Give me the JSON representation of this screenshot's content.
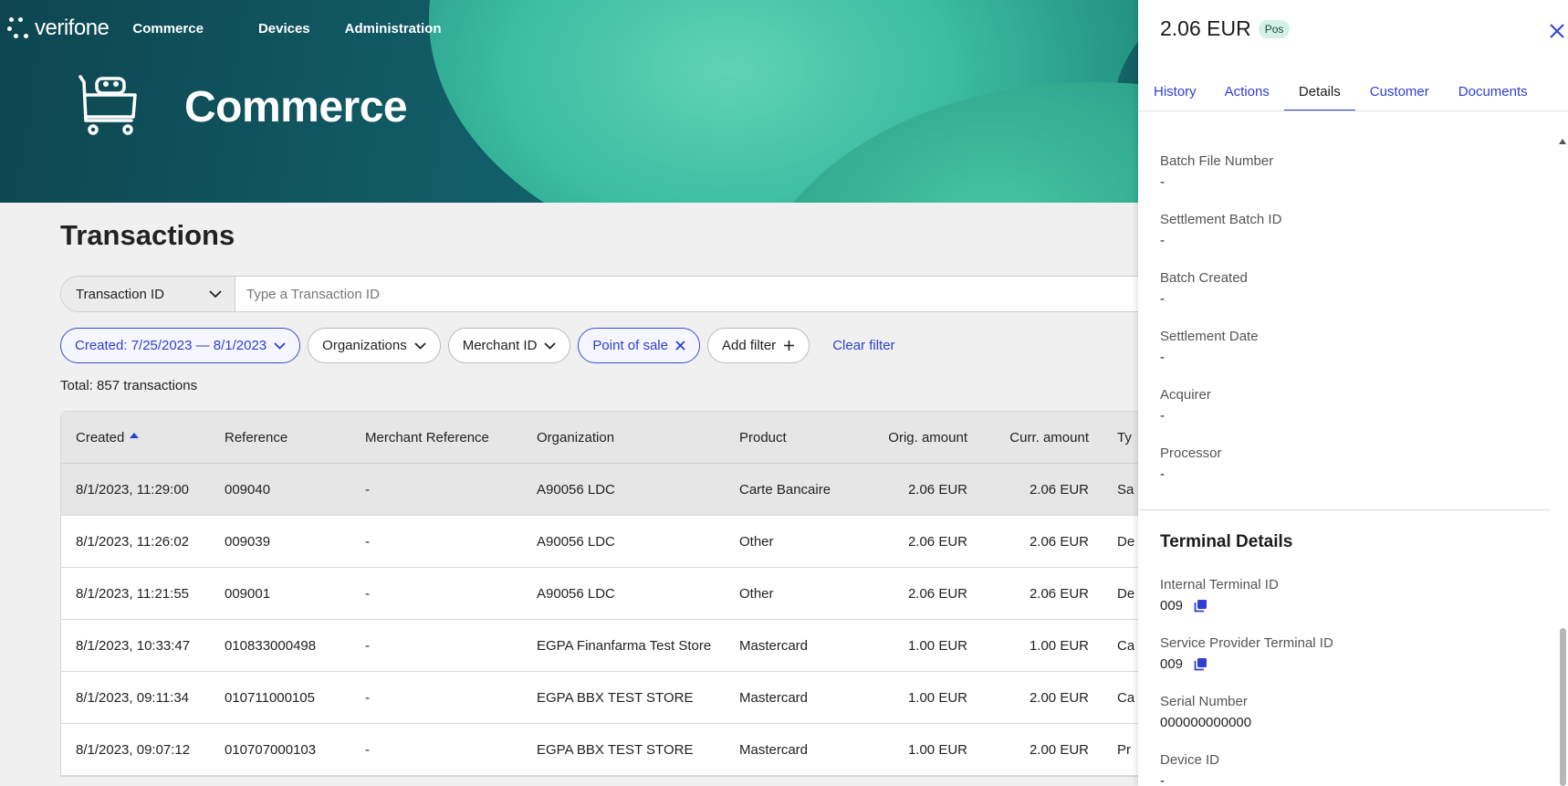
{
  "nav": {
    "logo": "verifone",
    "items": [
      {
        "label": "Commerce"
      },
      {
        "label": "Devices"
      },
      {
        "label": "Administration"
      }
    ]
  },
  "hero": {
    "title": "Commerce"
  },
  "page": {
    "title": "Transactions"
  },
  "search": {
    "selector": "Transaction ID",
    "placeholder": "Type a Transaction ID",
    "value": ""
  },
  "filters": {
    "created": "Created: 7/25/2023 — 8/1/2023",
    "organizations": "Organizations",
    "merchant_id": "Merchant ID",
    "point_of_sale": "Point of sale",
    "add_filter": "Add filter",
    "clear": "Clear filter"
  },
  "total": "Total: 857 transactions",
  "table": {
    "columns": [
      "Created",
      "Reference",
      "Merchant Reference",
      "Organization",
      "Product",
      "Orig. amount",
      "Curr. amount",
      "Ty"
    ],
    "rows": [
      [
        "8/1/2023, 11:29:00",
        "009040",
        "-",
        "A90056 LDC",
        "Carte Bancaire",
        "2.06 EUR",
        "2.06 EUR",
        "Sa"
      ],
      [
        "8/1/2023, 11:26:02",
        "009039",
        "-",
        "A90056 LDC",
        "Other",
        "2.06 EUR",
        "2.06 EUR",
        "De"
      ],
      [
        "8/1/2023, 11:21:55",
        "009001",
        "-",
        "A90056 LDC",
        "Other",
        "2.06 EUR",
        "2.06 EUR",
        "De"
      ],
      [
        "8/1/2023, 10:33:47",
        "010833000498",
        "-",
        "EGPA Finanfarma Test Store",
        "Mastercard",
        "1.00 EUR",
        "1.00 EUR",
        "Ca"
      ],
      [
        "8/1/2023, 09:11:34",
        "010711000105",
        "-",
        "EGPA BBX TEST STORE",
        "Mastercard",
        "1.00 EUR",
        "2.00 EUR",
        "Ca"
      ],
      [
        "8/1/2023, 09:07:12",
        "010707000103",
        "-",
        "EGPA BBX TEST STORE",
        "Mastercard",
        "1.00 EUR",
        "2.00 EUR",
        "Pr"
      ]
    ]
  },
  "panel": {
    "amount": "2.06 EUR",
    "badge": "Pos",
    "tabs": [
      "History",
      "Actions",
      "Details",
      "Customer",
      "Documents"
    ],
    "active_tab": "Details",
    "fields": [
      {
        "label": "Batch File Number",
        "value": "-"
      },
      {
        "label": "Settlement Batch ID",
        "value": "-"
      },
      {
        "label": "Batch Created",
        "value": "-"
      },
      {
        "label": "Settlement Date",
        "value": "-"
      },
      {
        "label": "Acquirer",
        "value": "-"
      },
      {
        "label": "Processor",
        "value": "-"
      }
    ],
    "section_title": "Terminal Details",
    "terminal_fields": [
      {
        "label": "Internal Terminal ID",
        "value": "009"
      },
      {
        "label": "Service Provider Terminal ID",
        "value": "009"
      },
      {
        "label": "Serial Number",
        "value": "000000000000"
      },
      {
        "label": "Device ID",
        "value": "-"
      }
    ]
  },
  "colors": {
    "accent": "#2f3fd0",
    "hero_dark": "#0d4650",
    "hero_light": "#5fd3b4",
    "badge_bg": "#d4f1e6"
  }
}
